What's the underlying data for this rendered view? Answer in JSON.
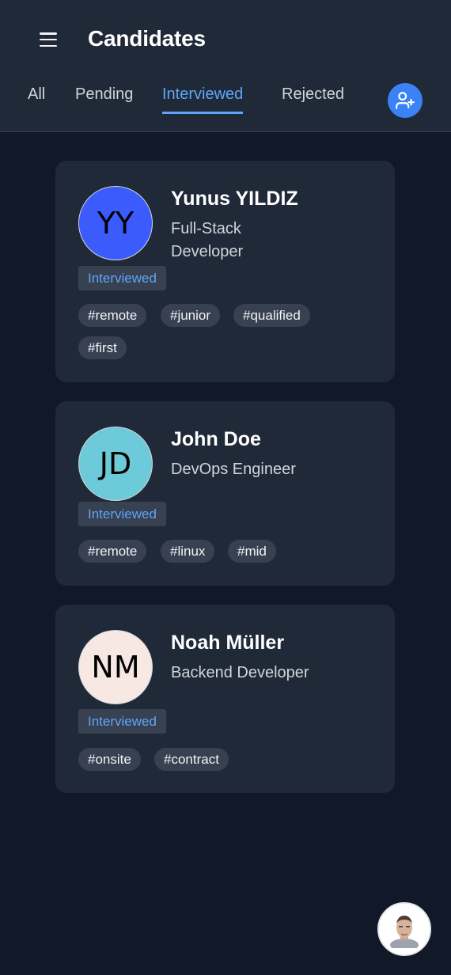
{
  "header": {
    "title": "Candidates",
    "tabs": [
      {
        "label": "All"
      },
      {
        "label": "Pending"
      },
      {
        "label": "Interviewed"
      },
      {
        "label": "Rejected"
      }
    ],
    "active_tab": "Interviewed",
    "menu_icon": "hamburger-menu-icon",
    "add_icon": "user-plus-icon"
  },
  "candidates": [
    {
      "initials": "YY",
      "name": "Yunus YILDIZ",
      "role": "Full-Stack Developer",
      "status": "Interviewed",
      "avatar_color": "#3b5bfd",
      "tags": [
        "#remote",
        "#junior",
        "#qualified",
        "#first"
      ]
    },
    {
      "initials": "JD",
      "name": "John Doe",
      "role": "DevOps Engineer",
      "status": "Interviewed",
      "avatar_color": "#6ccad9",
      "tags": [
        "#remote",
        "#linux",
        "#mid"
      ]
    },
    {
      "initials": "NM",
      "name": "Noah Müller",
      "role": "Backend Developer",
      "status": "Interviewed",
      "avatar_color": "#f8e8e4",
      "tags": [
        "#onsite",
        "#contract"
      ]
    }
  ],
  "fab": {
    "icon": "profile-avatar-icon"
  },
  "colors": {
    "background": "#111827",
    "card": "#1f2937",
    "accent": "#60a5fa",
    "button": "#3b82f6"
  }
}
